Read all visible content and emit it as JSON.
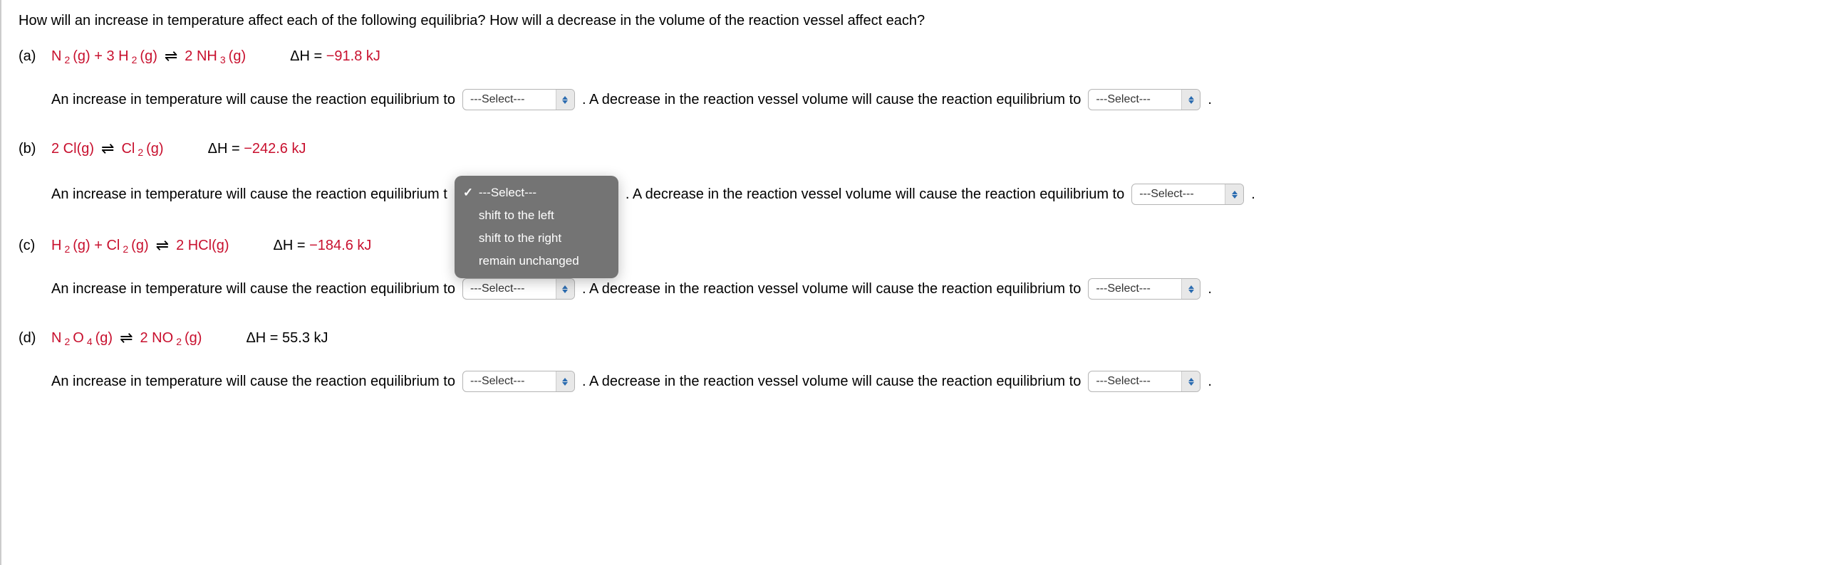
{
  "intro": "How will an increase in temperature affect each of the following equilibria? How will a decrease in the volume of the reaction vessel affect each?",
  "labels": {
    "a": "(a)",
    "b": "(b)",
    "c": "(c)",
    "d": "(d)"
  },
  "eq": {
    "a": {
      "l1": "N",
      "l1s": "2",
      "l2": "(g) + 3 H",
      "l2s": "2",
      "l3": "(g)",
      "r1": "2 NH",
      "r1s": "3",
      "r2": "(g)",
      "dh_label": "ΔH = ",
      "dh_val": "−91.8 kJ"
    },
    "b": {
      "l1": "2 Cl(g)",
      "r1": "Cl",
      "r1s": "2",
      "r2": "(g)",
      "dh_label": "ΔH = ",
      "dh_val": "−242.6 kJ"
    },
    "c": {
      "l1": "H",
      "l1s": "2",
      "l2": "(g) + Cl",
      "l2s": "2",
      "l3": "(g)",
      "r1": "2 HCl(g)",
      "dh_label": "ΔH = ",
      "dh_val": "−184.6 kJ"
    },
    "d": {
      "l1": "N",
      "l1s": "2",
      "l2": "O",
      "l2s": "4",
      "l3": "(g)",
      "r1": "2 NO",
      "r1s": "2",
      "r2": "(g)",
      "dh_label": "ΔH = ",
      "dh_val": "55.3 kJ"
    }
  },
  "sentence": {
    "temp": "An increase in temperature will cause the reaction equilibrium to",
    "temp_trunc": "An increase in temperature will cause the reaction equilibrium t",
    "vol": ". A decrease in the reaction vessel volume will cause the reaction equilibrium to",
    "period": "."
  },
  "select_placeholder": "---Select---",
  "dropdown": {
    "opt0": "---Select---",
    "opt1": "shift to the left",
    "opt2": "shift to the right",
    "opt3": "remain unchanged"
  },
  "arrow": "⇌"
}
